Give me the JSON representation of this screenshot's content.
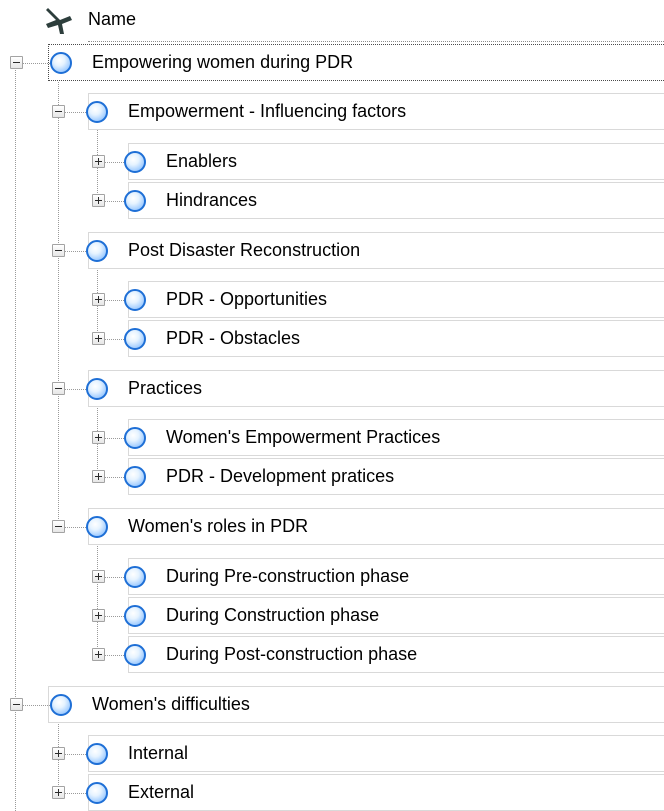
{
  "header": {
    "column_label": "Name",
    "pin_icon": "pushpin-icon"
  },
  "tree": {
    "node_icon": "node-sphere-icon",
    "expanded_icon": "minus-box-icon",
    "collapsed_icon": "plus-box-icon",
    "nodes": [
      {
        "id": "n1",
        "label": "Empowering women during PDR",
        "level": 0,
        "expanded": true,
        "selected": true
      },
      {
        "id": "n1a",
        "label": "Empowerment - Influencing factors",
        "level": 1,
        "expanded": true
      },
      {
        "id": "n1a1",
        "label": "Enablers",
        "level": 2,
        "expanded": false
      },
      {
        "id": "n1a2",
        "label": "Hindrances",
        "level": 2,
        "expanded": false
      },
      {
        "id": "n1b",
        "label": "Post Disaster Reconstruction",
        "level": 1,
        "expanded": true
      },
      {
        "id": "n1b1",
        "label": "PDR -  Opportunities",
        "level": 2,
        "expanded": false
      },
      {
        "id": "n1b2",
        "label": "PDR -  Obstacles",
        "level": 2,
        "expanded": false
      },
      {
        "id": "n1c",
        "label": "Practices",
        "level": 1,
        "expanded": true
      },
      {
        "id": "n1c1",
        "label": "Women's Empowerment Practices",
        "level": 2,
        "expanded": false
      },
      {
        "id": "n1c2",
        "label": "PDR - Development pratices",
        "level": 2,
        "expanded": false
      },
      {
        "id": "n1d",
        "label": "Women's roles in PDR",
        "level": 1,
        "expanded": true
      },
      {
        "id": "n1d1",
        "label": "During Pre-construction phase",
        "level": 2,
        "expanded": false
      },
      {
        "id": "n1d2",
        "label": "During Construction phase",
        "level": 2,
        "expanded": false
      },
      {
        "id": "n1d3",
        "label": "During Post-construction phase",
        "level": 2,
        "expanded": false
      },
      {
        "id": "n2",
        "label": "Women's difficulties",
        "level": 0,
        "expanded": true
      },
      {
        "id": "n2a",
        "label": "Internal",
        "level": 1,
        "expanded": false
      },
      {
        "id": "n2b",
        "label": "External",
        "level": 1,
        "expanded": false
      }
    ]
  }
}
